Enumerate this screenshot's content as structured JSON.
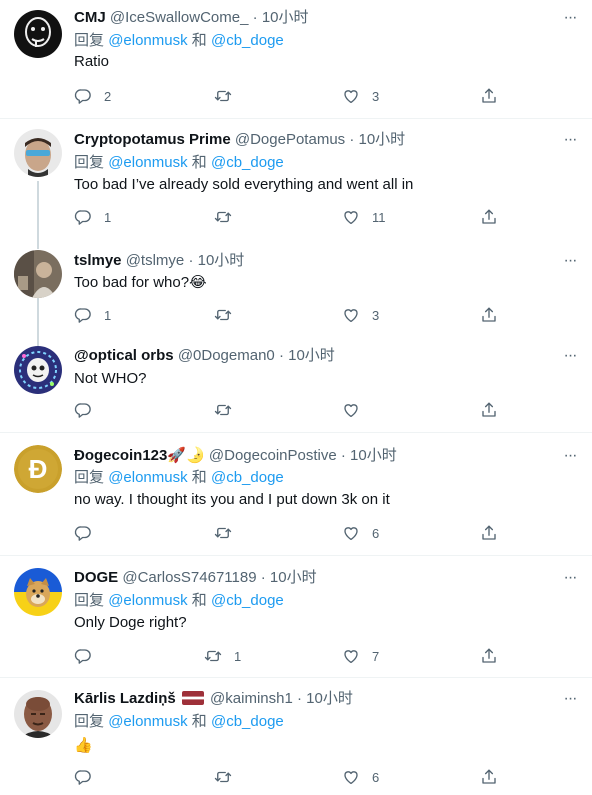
{
  "tweets": [
    {
      "name": "CMJ",
      "handle": "@IceSwallowCome_",
      "time": "10小时",
      "reply_prefix": "回复",
      "mention1": "@elonmusk",
      "conj": "和",
      "mention2": "@cb_doge",
      "text": "Ratio",
      "replies": "2",
      "retweets": "",
      "likes": "3"
    },
    {
      "name": "Cryptopotamus Prime",
      "handle": "@DogePotamus",
      "time": "10小时",
      "reply_prefix": "回复",
      "mention1": "@elonmusk",
      "conj": "和",
      "mention2": "@cb_doge",
      "text": "Too bad I’ve already sold everything and went all in",
      "replies": "1",
      "retweets": "",
      "likes": "11"
    },
    {
      "name": "tslmye",
      "handle": "@tslmye",
      "time": "10小时",
      "text": "Too bad for who?😂",
      "replies": "1",
      "retweets": "",
      "likes": "3"
    },
    {
      "name": "@optical orbs",
      "handle": "@0Dogeman0",
      "time": "10小时",
      "text": "Not WHO?",
      "replies": "",
      "retweets": "",
      "likes": ""
    },
    {
      "name": "Ðogecoin123🚀🌛",
      "handle": "@DogecoinPostive",
      "time": "10小时",
      "reply_prefix": "回复",
      "mention1": "@elonmusk",
      "conj": "和",
      "mention2": "@cb_doge",
      "text": "no way. I thought its you and I put down 3k on it",
      "replies": "",
      "retweets": "",
      "likes": "6"
    },
    {
      "name": "DOGE",
      "handle": "@CarlosS74671189",
      "time": "10小时",
      "reply_prefix": "回复",
      "mention1": "@elonmusk",
      "conj": "和",
      "mention2": "@cb_doge",
      "text": "Only Doge right?",
      "replies": "",
      "retweets": "1",
      "likes": "7"
    },
    {
      "name": "Kārlis Lazdiņš",
      "handle": "@kaiminsh1",
      "time": "10小时",
      "reply_prefix": "回复",
      "mention1": "@elonmusk",
      "conj": "和",
      "mention2": "@cb_doge",
      "text": "👍",
      "replies": "",
      "retweets": "",
      "likes": "6"
    }
  ],
  "sep_dot": "·",
  "more_glyph": "···",
  "colors": {
    "accent": "#1d9bf0",
    "muted": "#536471",
    "text": "#0f1419",
    "thread_line": "#cfd9de",
    "separator": "#eff3f4"
  },
  "icons": [
    "reply-icon",
    "retweet-icon",
    "like-icon",
    "share-icon",
    "more-icon"
  ]
}
